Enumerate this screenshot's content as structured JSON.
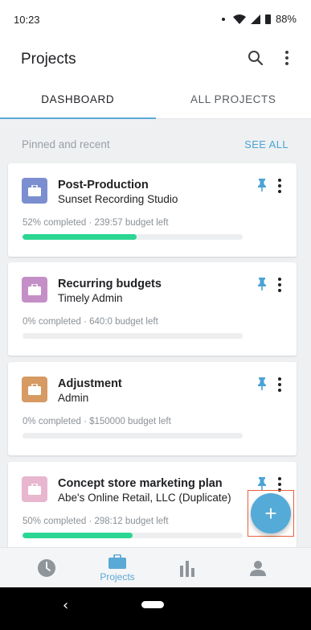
{
  "status_bar": {
    "time": "10:23",
    "battery": "88%"
  },
  "app_bar": {
    "title": "Projects",
    "search_icon": "search-icon",
    "more_icon": "more-vert-icon"
  },
  "tabs": [
    {
      "label": "DASHBOARD",
      "active": true
    },
    {
      "label": "ALL PROJECTS",
      "active": false
    }
  ],
  "section": {
    "label": "Pinned and recent",
    "see_all": "SEE ALL"
  },
  "projects": [
    {
      "name": "Post-Production",
      "client": "Sunset Recording Studio",
      "progress_text": "52% completed · 239:57 budget left",
      "progress": 0.52,
      "icon_color": "#7b8fd0"
    },
    {
      "name": "Recurring budgets",
      "client": "Timely Admin",
      "progress_text": "0% completed · 640:0 budget left",
      "progress": 0,
      "icon_color": "#c48fc6"
    },
    {
      "name": "Adjustment",
      "client": "Admin",
      "progress_text": "0% completed · $150000 budget left",
      "progress": 0,
      "icon_color": "#d69a62"
    },
    {
      "name": "Concept store marketing plan",
      "client": "Abe's Online Retail, LLC (Duplicate)",
      "progress_text": "50% completed · 298:12 budget left",
      "progress": 0.5,
      "icon_color": "#e8b6cf"
    }
  ],
  "bottom_nav": {
    "projects_label": "Projects"
  },
  "colors": {
    "accent": "#55abd8",
    "progress": "#2bd693",
    "pin": "#4aa3d6"
  }
}
